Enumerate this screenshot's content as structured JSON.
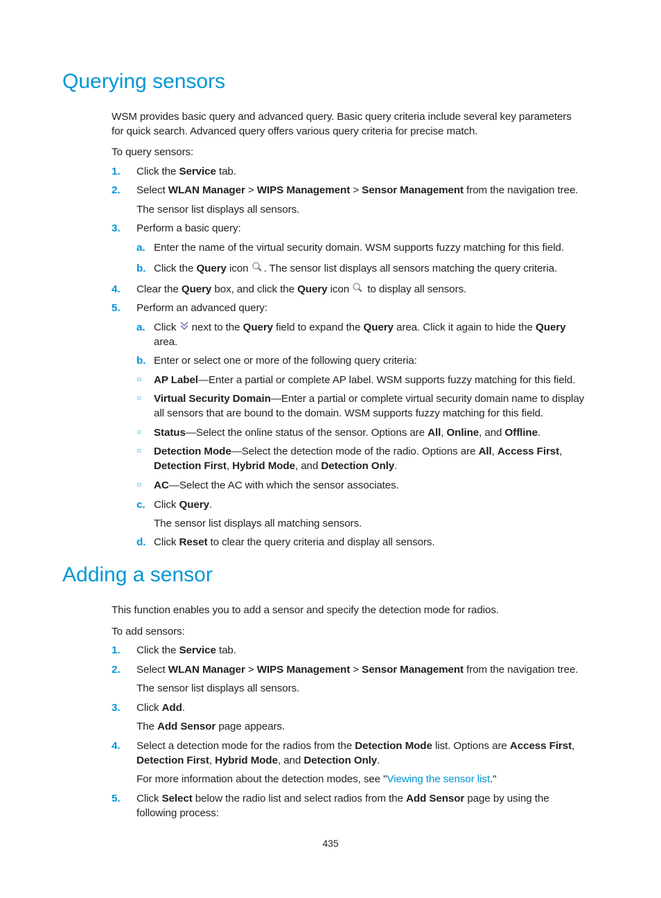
{
  "section1": {
    "title": "Querying sensors",
    "intro_1": "WSM provides basic query and advanced query. Basic query criteria include several key parameters",
    "intro_2": "for quick search. Advanced query offers various query criteria for precise match.",
    "lead": "To query sensors:",
    "steps": {
      "s1": {
        "num": "1.",
        "pre": "Click the ",
        "b1": "Service",
        "post": " tab."
      },
      "s2": {
        "num": "2.",
        "pre": "Select ",
        "b1": "WLAN Manager",
        "sep1": " > ",
        "b2": "WIPS Management",
        "sep2": " > ",
        "b3": "Sensor Management",
        "post": " from the navigation tree.",
        "result": "The sensor list displays all sensors."
      },
      "s3": {
        "num": "3.",
        "text": "Perform a basic query:",
        "a": {
          "num": "a.",
          "text": "Enter the name of the virtual security domain. WSM supports fuzzy matching for this field."
        },
        "b": {
          "num": "b.",
          "pre": "Click the ",
          "b1": "Query",
          "mid": " icon ",
          "post": ". The sensor list displays all sensors matching the query criteria."
        }
      },
      "s4": {
        "num": "4.",
        "pre": "Clear the ",
        "b1": "Query",
        "mid1": " box, and click the ",
        "b2": "Query",
        "mid2": " icon ",
        "post": " to display all sensors."
      },
      "s5": {
        "num": "5.",
        "text": "Perform an advanced query:",
        "a": {
          "num": "a.",
          "pre": "Click ",
          "mid1": " next to the ",
          "b1": "Query",
          "mid2": " field to expand the ",
          "b2": "Query",
          "mid3": " area. Click it again to hide the ",
          "b3": "Query",
          "post": "area."
        },
        "b": {
          "num": "b.",
          "text": "Enter or select one or more of the following query criteria:"
        },
        "criteria": {
          "ap": {
            "label": "AP Label",
            "text": "—Enter a partial or complete AP label. WSM supports fuzzy matching for this field."
          },
          "vsd": {
            "label": "Virtual Security Domain",
            "text": "—Enter a partial or complete virtual security domain name to display",
            "text2": "all sensors that are bound to the domain. WSM supports fuzzy matching for this field."
          },
          "status": {
            "label": "Status",
            "text": "—Select the online status of the sensor. Options are ",
            "o1": "All",
            "c1": ", ",
            "o2": "Online",
            "c2": ", and ",
            "o3": "Offline",
            "end": "."
          },
          "dm": {
            "label": "Detection Mode",
            "text": "—Select the detection mode of the radio. Options are ",
            "o1": "All",
            "c1": ", ",
            "o2": "Access First",
            "c2": ",",
            "o3": "Detection First",
            "c3": ", ",
            "o4": "Hybrid Mode",
            "c4": ", and ",
            "o5": "Detection Only",
            "end": "."
          },
          "ac": {
            "label": "AC",
            "text": "—Select the AC with which the sensor associates."
          }
        },
        "c": {
          "num": "c.",
          "pre": "Click ",
          "b1": "Query",
          "post": ".",
          "result": "The sensor list displays all matching sensors."
        },
        "d": {
          "num": "d.",
          "pre": "Click ",
          "b1": "Reset",
          "post": " to clear the query criteria and display all sensors."
        }
      }
    }
  },
  "section2": {
    "title": "Adding a sensor",
    "intro": "This function enables you to add a sensor and specify the detection mode for radios.",
    "lead": "To add sensors:",
    "steps": {
      "s1": {
        "num": "1.",
        "pre": "Click the ",
        "b1": "Service",
        "post": " tab."
      },
      "s2": {
        "num": "2.",
        "pre": "Select ",
        "b1": "WLAN Manager",
        "sep1": " > ",
        "b2": "WIPS Management",
        "sep2": " > ",
        "b3": "Sensor Management",
        "post": " from the navigation tree.",
        "result": "The sensor list displays all sensors."
      },
      "s3": {
        "num": "3.",
        "pre": "Click ",
        "b1": "Add",
        "post": ".",
        "r_pre": "The ",
        "r_b": "Add Sensor",
        "r_post": " page appears."
      },
      "s4": {
        "num": "4.",
        "pre": "Select a detection mode for the radios from the ",
        "b1": "Detection Mode",
        "mid": " list. Options are ",
        "b2": "Access First",
        "c1": ",",
        "b3": "Detection First",
        "c2": ", ",
        "b4": "Hybrid Mode",
        "c3": ", and ",
        "b5": "Detection Only",
        "end": ".",
        "more_pre": "For more information about the detection modes, see \"",
        "more_link": "Viewing the sensor list",
        "more_post": ".\""
      },
      "s5": {
        "num": "5.",
        "pre": "Click ",
        "b1": "Select",
        "mid": " below the radio list and select radios from the ",
        "b2": "Add Sensor",
        "post": " page by using the",
        "line2": "following process:"
      }
    }
  },
  "footer": {
    "page_number": "435"
  },
  "icons": {
    "query": "search-icon",
    "expand": "double-chevron-down-icon"
  },
  "colors": {
    "accent": "#0096d6",
    "text": "#231f20"
  }
}
